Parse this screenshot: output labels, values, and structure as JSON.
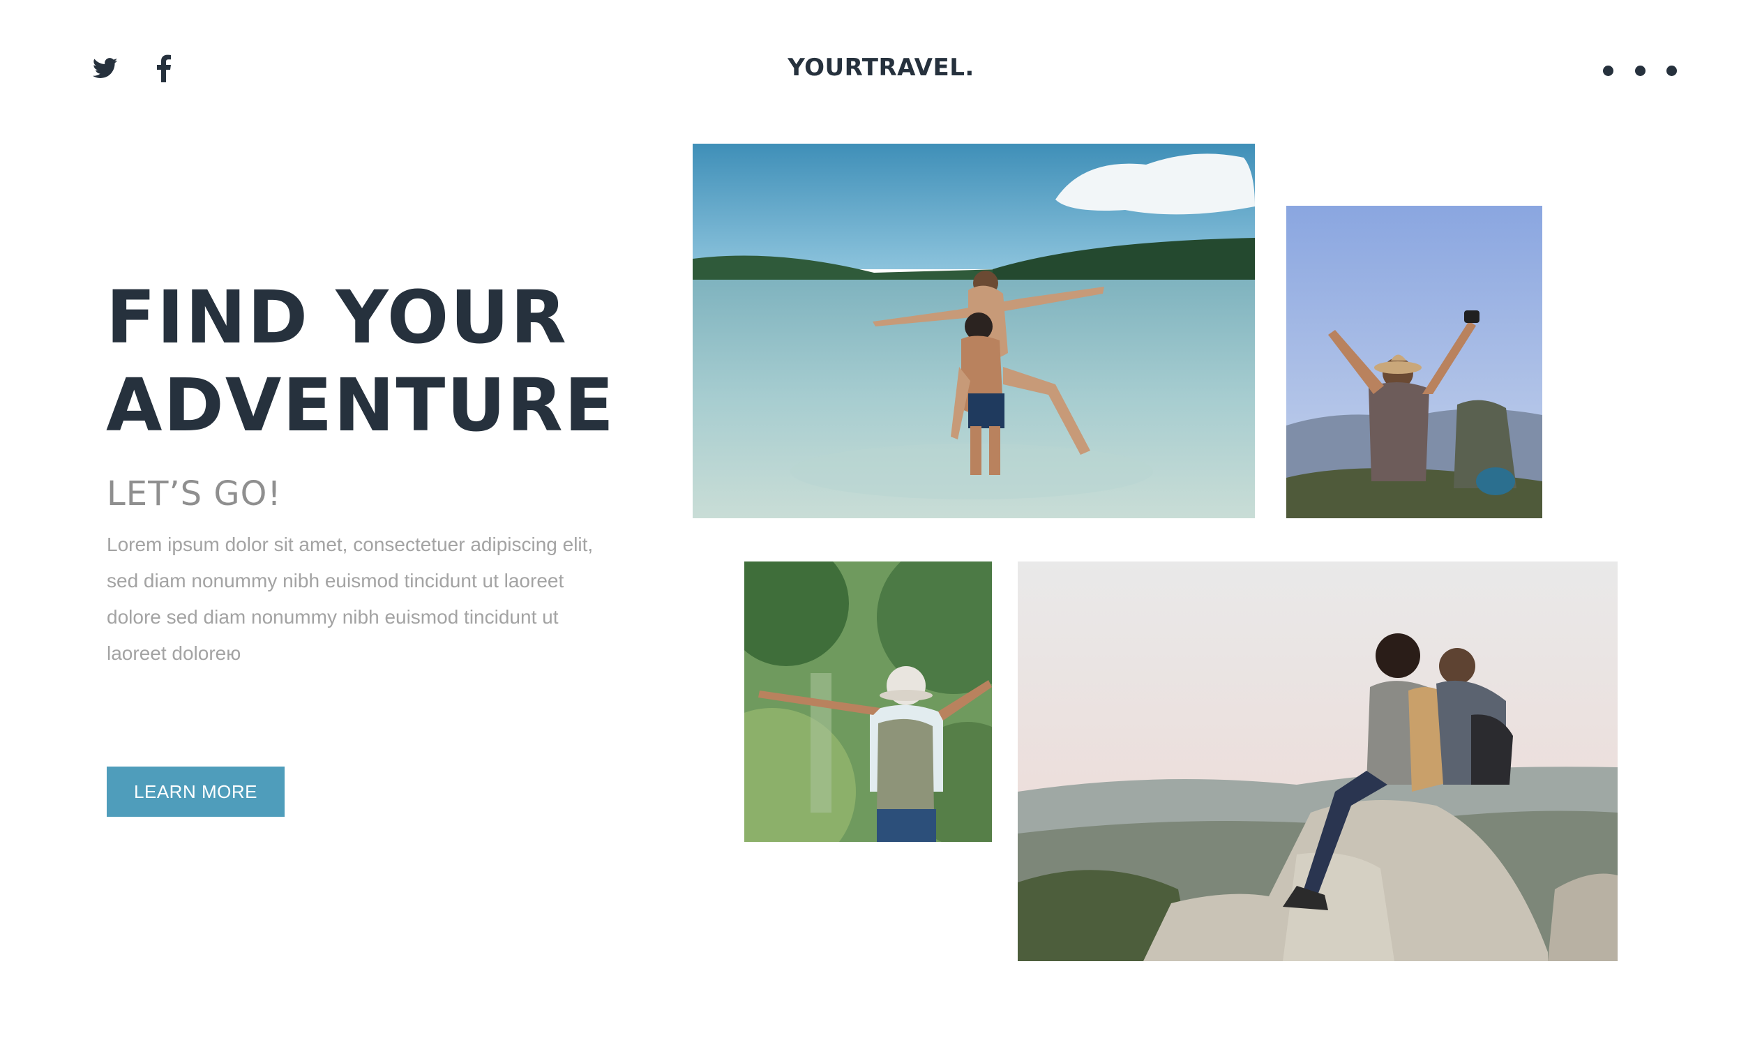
{
  "header": {
    "brand": "YOURTRAVEL.",
    "social": [
      {
        "icon": "twitter-icon"
      },
      {
        "icon": "facebook-icon"
      }
    ],
    "menu_icon": "more-dots-icon"
  },
  "hero": {
    "headline_line1": "FIND YOUR",
    "headline_line2": "ADVENTURE",
    "subheadline": "LET’S GO!",
    "body": "Lorem ipsum dolor sit amet, consectetuer adipiscing elit, sed diam nonummy nibh euismod tincidunt ut laoreet dolore sed diam nonummy nibh euismod tincidunt ut laoreet doloreю",
    "cta_label": "LEARN MORE"
  },
  "photos": [
    {
      "name": "photo-couple-beach"
    },
    {
      "name": "photo-hiker-summit"
    },
    {
      "name": "photo-backpacker-forest"
    },
    {
      "name": "photo-couple-cliff"
    }
  ],
  "colors": {
    "text_dark": "#26313d",
    "text_muted": "#8f8f8f",
    "body_text": "#a3a3a3",
    "accent": "#4f9dbb",
    "background": "#ffffff"
  }
}
